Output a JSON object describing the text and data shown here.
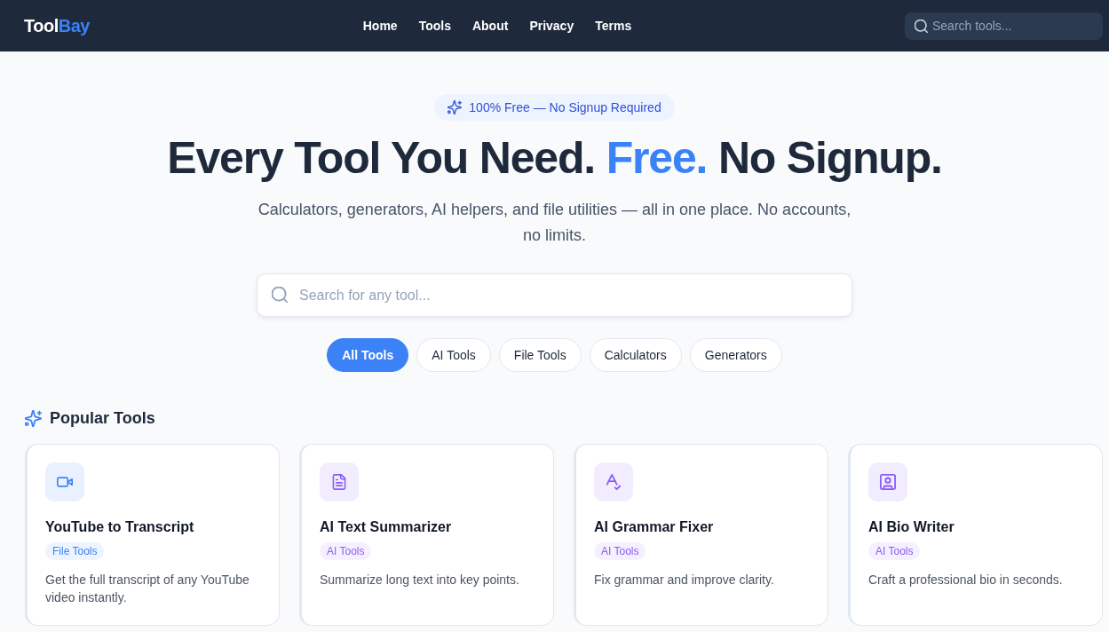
{
  "header": {
    "logo": [
      {
        "text": "Tool",
        "accent": false
      },
      {
        "text": "Bay",
        "accent": true
      }
    ],
    "nav": [
      "Home",
      "Tools",
      "About",
      "Privacy",
      "Terms"
    ],
    "search": {
      "placeholder": "Search tools..."
    }
  },
  "hero": {
    "badge": "100% Free — No Signup Required",
    "title": [
      {
        "text": "Every Tool You Need.",
        "accent": false
      },
      {
        "text": "Free.",
        "accent": true
      },
      {
        "text": "No Signup.",
        "accent": false
      }
    ],
    "subtitle": "Calculators, generators, AI helpers, and file utilities — all in one place. No accounts, no limits.",
    "search": {
      "placeholder": "Search for any tool..."
    },
    "filters": [
      {
        "label": "All Tools",
        "selected": true
      },
      {
        "label": "AI Tools",
        "selected": false
      },
      {
        "label": "File Tools",
        "selected": false
      },
      {
        "label": "Calculators",
        "selected": false
      },
      {
        "label": "Generators",
        "selected": false
      }
    ]
  },
  "popular": {
    "heading": "Popular Tools",
    "tools": [
      {
        "kind": "video",
        "title": "YouTube to Transcript",
        "category": "File Tools",
        "color": "#3b82f6",
        "description": "Get the full transcript of any YouTube video instantly."
      },
      {
        "kind": "document",
        "title": "AI Text Summarizer",
        "category": "AI Tools",
        "color": "#8b5cf6",
        "description": "Summarize long text into key points."
      },
      {
        "kind": "spellcheck",
        "title": "AI Grammar Fixer",
        "category": "AI Tools",
        "color": "#8b5cf6",
        "description": "Fix grammar and improve clarity."
      },
      {
        "kind": "profile",
        "title": "AI Bio Writer",
        "category": "AI Tools",
        "color": "#8b5cf6",
        "description": "Craft a professional bio in seconds."
      }
    ]
  }
}
